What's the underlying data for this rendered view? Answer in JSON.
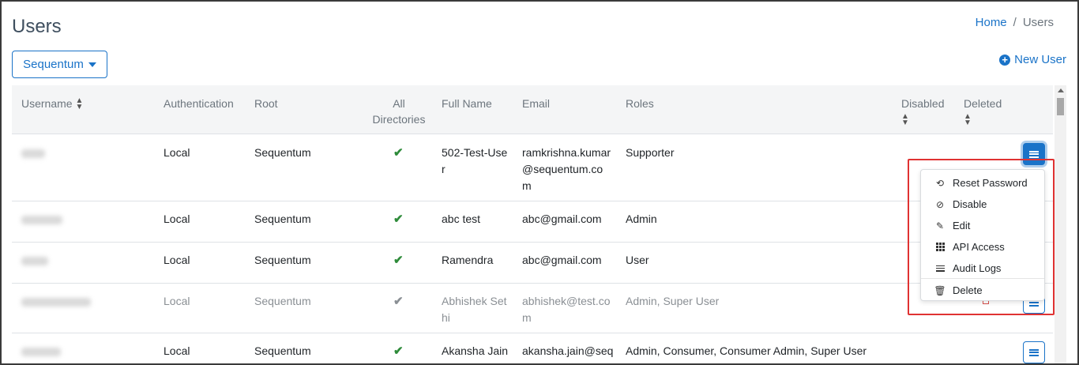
{
  "page": {
    "title": "Users"
  },
  "breadcrumb": {
    "home": "Home",
    "separator": "/",
    "current": "Users"
  },
  "directory_selector": {
    "label": "Sequentum"
  },
  "new_user": {
    "label": "New User"
  },
  "table": {
    "headers": {
      "username": "Username",
      "authentication": "Authentication",
      "root": "Root",
      "all_dirs_line1": "All",
      "all_dirs_line2": "Directories",
      "full_name": "Full Name",
      "email": "Email",
      "roles": "Roles",
      "disabled": "Disabled",
      "deleted": "Deleted"
    },
    "rows": [
      {
        "auth": "Local",
        "root": "Sequentum",
        "full_name_1": "502-Test-Use",
        "full_name_2": "r",
        "email_1": "ramkrishna.kumar",
        "email_2": "@sequentum.co",
        "email_3": "m",
        "roles": "Supporter",
        "dimmed": false
      },
      {
        "auth": "Local",
        "root": "Sequentum",
        "full_name_1": "abc test",
        "email_1": "abc@gmail.com",
        "roles": "Admin",
        "dimmed": false
      },
      {
        "auth": "Local",
        "root": "Sequentum",
        "full_name_1": "Ramendra",
        "email_1": "abc@gmail.com",
        "roles": "User",
        "dimmed": false
      },
      {
        "auth": "Local",
        "root": "Sequentum",
        "full_name_1": "Abhishek Set",
        "full_name_2": "hi",
        "email_1": "abhishek@test.co",
        "email_2": "m",
        "roles": "Admin, Super User",
        "dimmed": true
      },
      {
        "auth": "Local",
        "root": "Sequentum",
        "full_name_1": "Akansha Jain",
        "email_1": "akansha.jain@seq",
        "roles": "Admin, Consumer, Consumer Admin, Super User",
        "dimmed": false
      }
    ]
  },
  "action_menu": {
    "items": [
      {
        "label": "Reset Password",
        "icon": "undo-icon"
      },
      {
        "label": "Disable",
        "icon": "ban-icon"
      },
      {
        "label": "Edit",
        "icon": "edit-icon"
      },
      {
        "label": "API Access",
        "icon": "grid-icon"
      },
      {
        "label": "Audit Logs",
        "icon": "list-icon"
      },
      {
        "label": "Delete",
        "icon": "trash-icon"
      }
    ]
  },
  "colors": {
    "accent": "#1a73c8",
    "check": "#2e8b3a",
    "highlight": "#e03232"
  }
}
